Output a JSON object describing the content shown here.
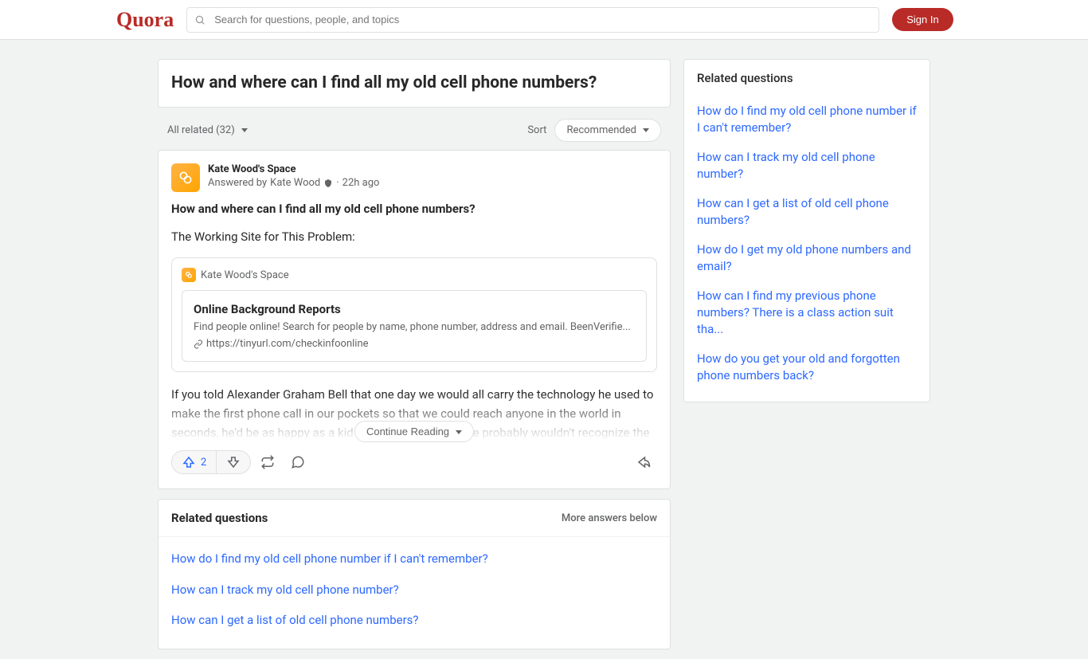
{
  "header": {
    "logo": "Quora",
    "search_placeholder": "Search for questions, people, and topics",
    "signin_label": "Sign In"
  },
  "question": {
    "title": "How and where can I find all my old cell phone numbers?"
  },
  "filter": {
    "all_related": "All related (32)",
    "sort_label": "Sort",
    "sort_value": "Recommended"
  },
  "answer": {
    "space_name": "Kate Wood's Space",
    "byline_prefix": "Answered by",
    "author": "Kate Wood",
    "timestamp": "22h ago",
    "question_repeat": "How and where can I find all my old cell phone numbers?",
    "intro": "The Working Site for This Problem:",
    "embed": {
      "source": "Kate Wood's Space",
      "title": "Online Background Reports",
      "description": "Find people online! Search for people by name, phone number, address and email. BeenVerifie...",
      "url": "https://tinyurl.com/checkinfoonline"
    },
    "body_faded": "If you told Alexander Graham Bell that one day we would all carry the technology he used to make the first phone call in our pockets so that we could reach anyone in the world in seconds, he'd be as happy as a kid in a candy shop. But he probably wouldn't recognize the",
    "continue_label": "Continue Reading",
    "upvote_count": "2"
  },
  "related_inline": {
    "title": "Related questions",
    "more_label": "More answers below",
    "links": [
      "How do I find my old cell phone number if I can't remember?",
      "How can I track my old cell phone number?",
      "How can I get a list of old cell phone numbers?"
    ]
  },
  "sidebar": {
    "title": "Related questions",
    "links": [
      "How do I find my old cell phone number if I can't remember?",
      "How can I track my old cell phone number?",
      "How can I get a list of old cell phone numbers?",
      "How do I get my old phone numbers and email?",
      "How can I find my previous phone numbers? There is a class action suit tha...",
      "How do you get your old and forgotten phone numbers back?"
    ]
  }
}
